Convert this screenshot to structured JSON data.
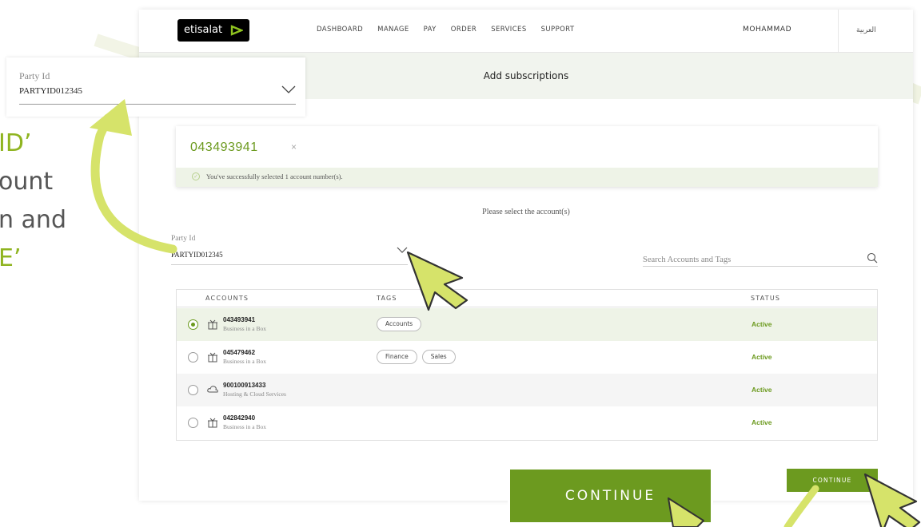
{
  "nav": {
    "logo": "etisalat",
    "links": [
      "DASHBOARD",
      "MANAGE",
      "PAY",
      "ORDER",
      "SERVICES",
      "SUPPORT"
    ],
    "user": "MOHAMMAD",
    "language": "العربية"
  },
  "page_title": "Add subscriptions",
  "selected_account": {
    "number": "043493941",
    "close": "×",
    "success_message": "You've successfully selected 1 account number(s)."
  },
  "instruction": "Please select the account(s)",
  "party": {
    "label": "Party Id",
    "value": "PARTYID012345"
  },
  "search": {
    "placeholder": "Search Accounts and Tags"
  },
  "table": {
    "headers": {
      "accounts": "ACCOUNTS",
      "tags": "TAGS",
      "status": "STATUS"
    },
    "rows": [
      {
        "number": "043493941",
        "type": "Business in a Box",
        "icon": "gift-icon",
        "tags": [
          "Accounts"
        ],
        "status": "Active",
        "selected": true
      },
      {
        "number": "045479462",
        "type": "Business in a Box",
        "icon": "gift-icon",
        "tags": [
          "Finance",
          "Sales"
        ],
        "status": "Active",
        "selected": false
      },
      {
        "number": "900100913433",
        "type": "Hosting & Cloud Services",
        "icon": "cloud-icon",
        "tags": [],
        "status": "Active",
        "selected": false
      },
      {
        "number": "042842940",
        "type": "Business in a Box",
        "icon": "gift-icon",
        "tags": [],
        "status": "Active",
        "selected": false
      }
    ]
  },
  "continue_label": "CONTINUE",
  "overlay": {
    "party": {
      "label": "Party Id",
      "value": "PARTYID012345"
    },
    "side_text": [
      "ID’",
      "ount",
      "n and",
      "E’"
    ],
    "continue_label": "CONTINUE"
  },
  "colors": {
    "brand_green": "#6c9a1f",
    "highlight_green": "#d6e36a",
    "success_bg": "#eef3e7"
  }
}
